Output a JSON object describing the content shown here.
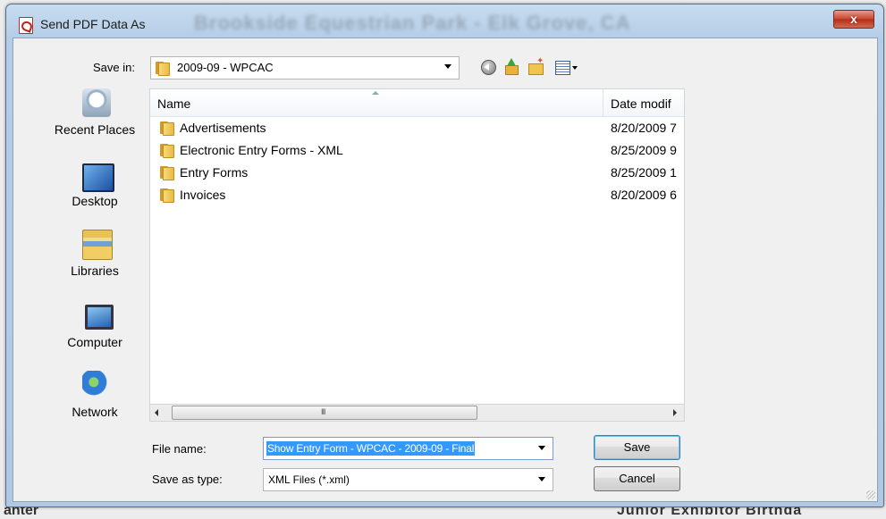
{
  "window": {
    "title": "Send PDF Data As",
    "background_title": "Brookside Equestrian Park - Elk Grove, CA",
    "close_label": "x"
  },
  "save_in": {
    "label": "Save in:",
    "value": "2009-09 - WPCAC"
  },
  "places": [
    {
      "label": "Recent Places",
      "icon": "recent-places-icon"
    },
    {
      "label": "Desktop",
      "icon": "desktop-icon"
    },
    {
      "label": "Libraries",
      "icon": "libraries-icon"
    },
    {
      "label": "Computer",
      "icon": "computer-icon"
    },
    {
      "label": "Network",
      "icon": "network-icon"
    }
  ],
  "file_list": {
    "columns": [
      "Name",
      "Date modif"
    ],
    "rows": [
      {
        "name": "Advertisements",
        "date": "8/20/2009 7"
      },
      {
        "name": "Electronic Entry Forms - XML",
        "date": "8/25/2009 9"
      },
      {
        "name": "Entry Forms",
        "date": "8/25/2009 1"
      },
      {
        "name": "Invoices",
        "date": "8/20/2009 6"
      }
    ],
    "scroll_grip": "III"
  },
  "file_name": {
    "label": "File name:",
    "value": "Show Entry Form - WPCAC - 2009-09 - Final"
  },
  "save_as_type": {
    "label": "Save as type:",
    "value": "XML Files (*.xml)"
  },
  "buttons": {
    "save": "Save",
    "cancel": "Cancel"
  },
  "background_text": {
    "left": "anter",
    "right": "Junior Exhibitor Birthda"
  },
  "colors": {
    "selection": "#3399ff",
    "title_gradient": "#c7dcf0",
    "close_button": "#c9452f"
  }
}
